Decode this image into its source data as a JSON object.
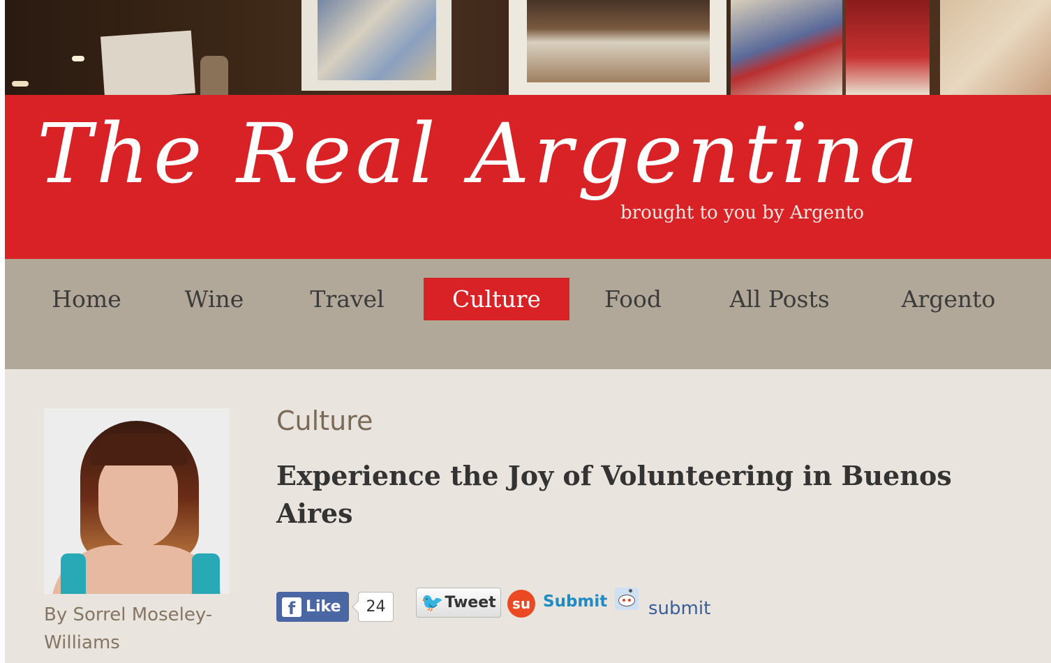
{
  "header": {
    "title": "The Real Argentina",
    "tagline": "brought to you by Argento"
  },
  "nav": {
    "items": [
      {
        "label": "Home"
      },
      {
        "label": "Wine"
      },
      {
        "label": "Travel"
      },
      {
        "label": "Culture",
        "active": true
      },
      {
        "label": "Food"
      },
      {
        "label": "All Posts"
      },
      {
        "label": "Argento"
      }
    ]
  },
  "post": {
    "category": "Culture",
    "title": "Experience the Joy of Volunteering in Buenos Aires",
    "author_line": "By Sorrel Moseley-Williams"
  },
  "social": {
    "facebook": {
      "label": "Like",
      "count": "24",
      "logo_glyph": "f"
    },
    "twitter": {
      "label": "Tweet",
      "bird_glyph": "🐦"
    },
    "stumbleupon": {
      "label": "Submit",
      "badge_glyph": "su"
    },
    "reddit": {
      "label": "submit"
    }
  },
  "colors": {
    "brand_red": "#d92226",
    "nav_bg": "#b2a899",
    "content_bg": "#e9e4dd",
    "facebook_blue": "#4a67a4",
    "stumble_orange": "#eb4924",
    "link_blue": "#1e8bc2"
  }
}
